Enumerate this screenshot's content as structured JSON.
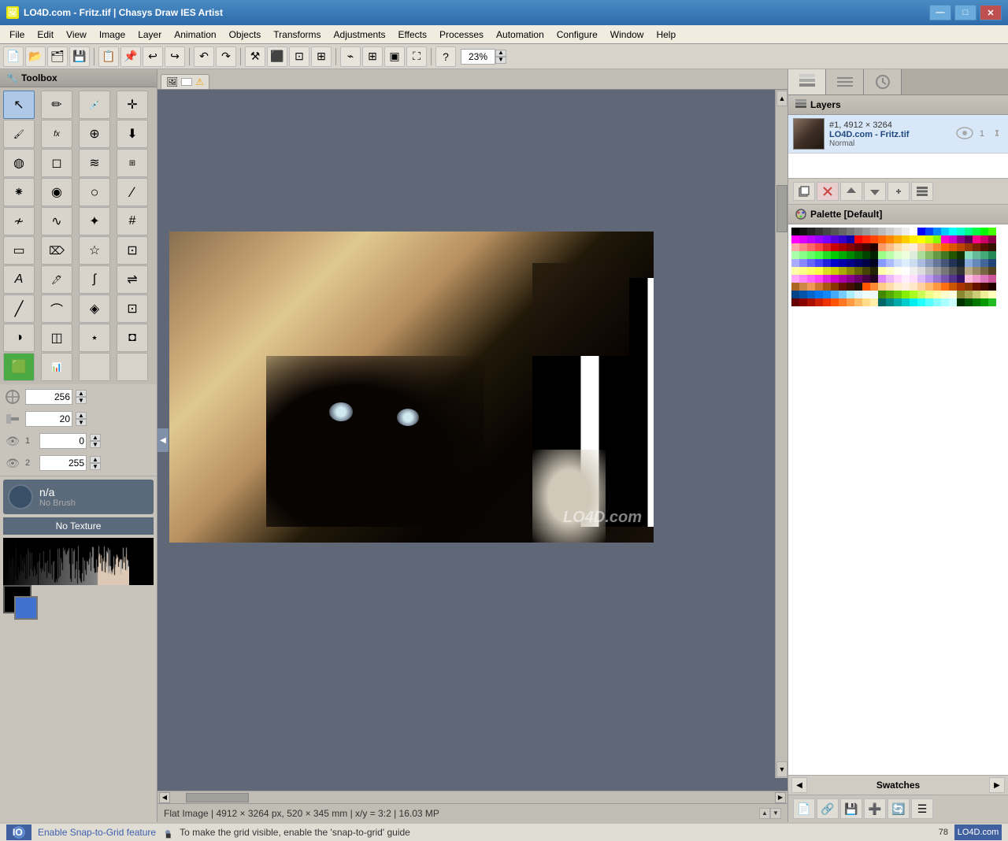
{
  "app": {
    "title": "LO4D.com - Fritz.tif | Chasys Draw IES Artist",
    "icon": "🖼"
  },
  "titlebar": {
    "minimize": "—",
    "maximize": "□",
    "close": "✕"
  },
  "menu": {
    "items": [
      "File",
      "Edit",
      "View",
      "Image",
      "Layer",
      "Animation",
      "Objects",
      "Transforms",
      "Adjustments",
      "Effects",
      "Processes",
      "Automation",
      "Configure",
      "Window",
      "Help"
    ]
  },
  "toolbar": {
    "zoom": "23%"
  },
  "toolbox": {
    "title": "Toolbox",
    "tools": [
      {
        "name": "pointer",
        "icon": "↖",
        "active": true
      },
      {
        "name": "pencil",
        "icon": "✏"
      },
      {
        "name": "eyedropper",
        "icon": "💉"
      },
      {
        "name": "move",
        "icon": "✛"
      },
      {
        "name": "brush",
        "icon": "🖌"
      },
      {
        "name": "fx",
        "icon": "fx"
      },
      {
        "name": "clone",
        "icon": "⊕"
      },
      {
        "name": "fill",
        "icon": "⊞"
      },
      {
        "name": "spray",
        "icon": "◍"
      },
      {
        "name": "erase",
        "icon": "◻"
      },
      {
        "name": "smear",
        "icon": "≋"
      },
      {
        "name": "pattern",
        "icon": "⊞"
      },
      {
        "name": "scatter",
        "icon": "⁕"
      },
      {
        "name": "blur",
        "icon": "◉"
      },
      {
        "name": "sphere",
        "icon": "○"
      },
      {
        "name": "scratch",
        "icon": "∕"
      },
      {
        "name": "warp",
        "icon": "≁"
      },
      {
        "name": "bspline",
        "icon": "∿"
      },
      {
        "name": "star",
        "icon": "✦"
      },
      {
        "name": "hash",
        "icon": "#"
      },
      {
        "name": "select-rect",
        "icon": "▭"
      },
      {
        "name": "crop",
        "icon": "⌦"
      },
      {
        "name": "select-magic",
        "icon": "☆"
      },
      {
        "name": "zoom-select",
        "icon": "⊡"
      },
      {
        "name": "text",
        "icon": "A"
      },
      {
        "name": "pen",
        "icon": "🖊"
      },
      {
        "name": "bezier",
        "icon": "∫"
      },
      {
        "name": "transform",
        "icon": "⇌"
      },
      {
        "name": "line",
        "icon": "╱"
      },
      {
        "name": "curve",
        "icon": "⌒"
      },
      {
        "name": "select-layer",
        "icon": "◈"
      },
      {
        "name": "rect-select2",
        "icon": "⊡"
      },
      {
        "name": "gradient",
        "icon": "◑"
      },
      {
        "name": "3d",
        "icon": "◫"
      },
      {
        "name": "distort",
        "icon": "⋆"
      },
      {
        "name": "cut",
        "icon": "◘"
      },
      {
        "name": "color",
        "icon": "🟩"
      },
      {
        "name": "chart",
        "icon": "📊"
      }
    ]
  },
  "tool_props": {
    "value1": "256",
    "value2": "20",
    "label1": "1",
    "value3": "0",
    "label2": "2",
    "value4": "255"
  },
  "brush": {
    "name": "n/a",
    "label": "No Brush",
    "texture": "No Texture"
  },
  "canvas": {
    "tab_icon": "🖼",
    "tab_alert": "⚠",
    "status": "Flat Image | 4912 × 3264 px, 520 × 345 mm | x/y = 3:2 | 16.03 MP"
  },
  "layers": {
    "title": "Layers",
    "layer1": {
      "number": "#1, 4912 × 3264",
      "name": "LO4D.com - Fritz.tif",
      "mode": "Normal",
      "link_num": "1"
    }
  },
  "palette": {
    "title": "Palette [Default]",
    "nav_label": "Swatches",
    "actions": [
      "📄",
      "🔗",
      "💾",
      "➕",
      "🔄",
      "☰"
    ]
  },
  "statusbar": {
    "message": "Enable Snap-to-Grid feature",
    "separator": "■",
    "tip": "To make the grid visible, enable the 'snap-to-grid' guide",
    "number": "78"
  },
  "colors": {
    "row1": [
      "#000000",
      "#111111",
      "#222222",
      "#333333",
      "#444444",
      "#555555",
      "#666666",
      "#777777",
      "#888888",
      "#999999",
      "#aaaaaa",
      "#bbbbbb",
      "#cccccc",
      "#dddddd",
      "#eeeeee",
      "#ffffff",
      "#0000ff",
      "#0044ff",
      "#0088ff",
      "#00ccff",
      "#00ffff",
      "#00ffcc",
      "#00ff88",
      "#00ff44",
      "#00ff00",
      "#44ff00"
    ],
    "row2": [
      "#ff00ff",
      "#dd00ff",
      "#bb00ff",
      "#9900ff",
      "#7700ff",
      "#5500ff",
      "#3300ff",
      "#1100ff",
      "#ff0000",
      "#ff2200",
      "#ff4400",
      "#ff6600",
      "#ff8800",
      "#ffaa00",
      "#ffcc00",
      "#ffee00",
      "#ffff00",
      "#ccff00",
      "#88ff00",
      "#ff00cc",
      "#cc00cc",
      "#880088",
      "#550055",
      "#ff0088",
      "#cc0066",
      "#880044"
    ],
    "row3": [
      "#ff8888",
      "#ffaaaa",
      "#ffcccc",
      "#ff6666",
      "#ff4444",
      "#dd2222",
      "#cc0000",
      "#aa0000",
      "#880000",
      "#660000",
      "#440000",
      "#ff9966",
      "#ffbb88",
      "#ffddaa",
      "#ffeecc",
      "#ffeedd",
      "#ffcc99",
      "#ffaa66",
      "#ff8833",
      "#ff6600",
      "#dd5500",
      "#bb4400",
      "#993300",
      "#772200",
      "#551100",
      "#331100"
    ],
    "row4": [
      "#88ff88",
      "#aaffaa",
      "#ccffcc",
      "#66ff66",
      "#44ff44",
      "#22dd22",
      "#00cc00",
      "#00aa00",
      "#008800",
      "#006600",
      "#004400",
      "#99ff88",
      "#bbffaa",
      "#ddffcc",
      "#eeffdd",
      "#ddeedd",
      "#aadd99",
      "#88bb66",
      "#669944",
      "#447722",
      "#225500",
      "#113300",
      "#88ddbb",
      "#66bb99",
      "#44aa77",
      "#228855"
    ],
    "row5": [
      "#8888ff",
      "#aaaaff",
      "#ccccff",
      "#6666ff",
      "#4444ff",
      "#2222dd",
      "#0000cc",
      "#0000aa",
      "#000088",
      "#000066",
      "#000044",
      "#8899ff",
      "#aabbff",
      "#ccddff",
      "#ddeeff",
      "#ddeeff",
      "#aabbdd",
      "#8899bb",
      "#667799",
      "#445577",
      "#223355",
      "#112233",
      "#88aadd",
      "#6688bb",
      "#446699",
      "#224477"
    ],
    "row6": [
      "#ffff88",
      "#ffffaa",
      "#ffffcc",
      "#ffff66",
      "#ffff44",
      "#dddd22",
      "#cccc00",
      "#aaaa00",
      "#888800",
      "#666600",
      "#444400",
      "#ffffaa",
      "#ffffcc",
      "#ffffee",
      "#fefefe",
      "#f0f0f0",
      "#dddddd",
      "#bbbbbb",
      "#999999",
      "#777777",
      "#555555",
      "#333333",
      "#bbaa88",
      "#998866",
      "#776644",
      "#554422"
    ],
    "row7": [
      "#ff88ff",
      "#ffaaff",
      "#ffccff",
      "#ff66ff",
      "#ff44ff",
      "#dd22dd",
      "#cc00cc",
      "#aa00aa",
      "#880088",
      "#660066",
      "#440044",
      "#dd88ff",
      "#eeb8ff",
      "#ffd4ff",
      "#ffeeff",
      "#ffddff",
      "#ddbbff",
      "#bb99ee",
      "#9977cc",
      "#7755aa",
      "#553388",
      "#331166",
      "#ffbbdd",
      "#ee99cc",
      "#dd77bb",
      "#cc5599"
    ],
    "row8": [
      "#884400",
      "#aa6622",
      "#cc8844",
      "#ee9955",
      "#cc7733",
      "#aa5511",
      "#883300",
      "#661100",
      "#441100",
      "#ff5500",
      "#ffAA55",
      "#ffcc88",
      "#ffddaa",
      "#ffeecc",
      "#fff0e0",
      "#ffe8c8",
      "#ffd0a0",
      "#ffb870",
      "#ff9840",
      "#ff7010",
      "#cc5500",
      "#aa3300",
      "#883300",
      "#661100",
      "#440800",
      "#220000"
    ],
    "row9": [
      "#003366",
      "#004488",
      "#0055aa",
      "#0066cc",
      "#0077ee",
      "#1188ff",
      "#44aaff",
      "#77ccff",
      "#aaeeff",
      "#ddf4ff",
      "#eefbff",
      "#336600",
      "#448800",
      "#55aa00",
      "#66cc00",
      "#88ee00",
      "#aaff22",
      "#ccff55",
      "#eeff88",
      "#ffffaa",
      "#ffffcc",
      "#888833",
      "#aaaa55",
      "#cccc77",
      "#eeee99",
      "#ffffbb"
    ],
    "row10": [
      "#660000",
      "#880000",
      "#aa1100",
      "#cc2200",
      "#ee3300",
      "#ff5500",
      "#ff7722",
      "#ff9944",
      "#ffbb66",
      "#ffdd88",
      "#ffeeaa",
      "#006666",
      "#008888",
      "#00aaaa",
      "#00cccc",
      "#00eeee",
      "#22ffff",
      "#55ffff",
      "#88ffff",
      "#aaffff",
      "#ccffff",
      "#003300",
      "#005500",
      "#007700",
      "#009900",
      "#22bb22"
    ]
  }
}
